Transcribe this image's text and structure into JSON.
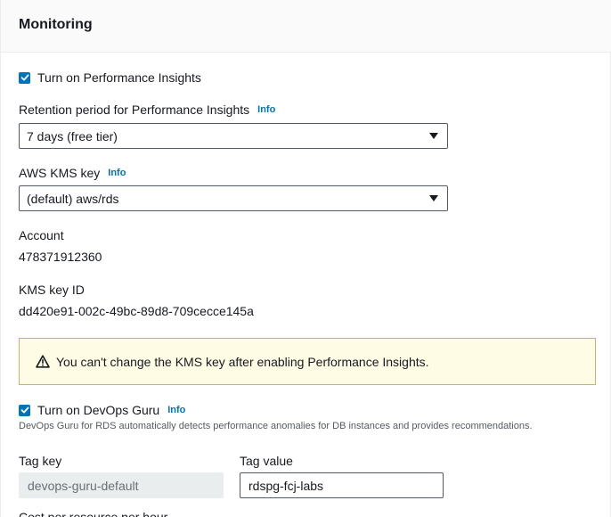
{
  "section": {
    "title": "Monitoring"
  },
  "performance_insights": {
    "checkbox_label": "Turn on Performance Insights",
    "checked": true,
    "retention_label": "Retention period for Performance Insights",
    "retention_info": "Info",
    "retention_value": "7 days (free tier)",
    "kms_label": "AWS KMS key",
    "kms_info": "Info",
    "kms_value": "(default) aws/rds",
    "account_label": "Account",
    "account_value": "478371912360",
    "kms_key_id_label": "KMS key ID",
    "kms_key_id_value": "dd420e91-002c-49bc-89d8-709cecce145a",
    "alert_text": "You can't change the KMS key after enabling Performance Insights."
  },
  "devops_guru": {
    "checkbox_label": "Turn on DevOps Guru",
    "checked": true,
    "info": "Info",
    "description": "DevOps Guru for RDS automatically detects performance anomalies for DB instances and provides recommendations.",
    "tag_key_label": "Tag key",
    "tag_key_value": "devops-guru-default",
    "tag_value_label": "Tag value",
    "tag_value_value": "rdspg-fcj-labs",
    "cost_label_partial": "Cost per resource per hour"
  },
  "colors": {
    "accent": "#0073bb",
    "alert_bg": "#fffce6",
    "alert_border": "#c9b06b",
    "disabled_bg": "#eaeded"
  }
}
